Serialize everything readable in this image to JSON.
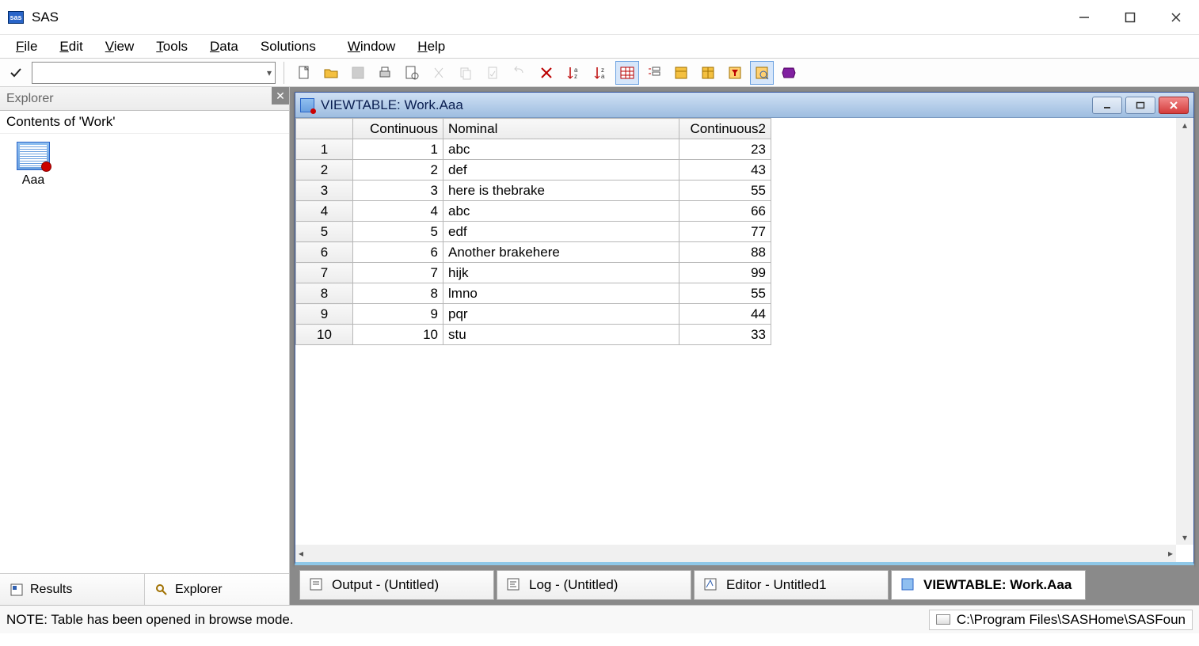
{
  "app": {
    "title": "SAS"
  },
  "menu": {
    "file": "File",
    "edit": "Edit",
    "view": "View",
    "tools": "Tools",
    "data": "Data",
    "solutions": "Solutions",
    "window": "Window",
    "help": "Help"
  },
  "explorer": {
    "title": "Explorer",
    "contents_label": "Contents of 'Work'",
    "item": "Aaa"
  },
  "left_tabs": {
    "results": "Results",
    "explorer": "Explorer"
  },
  "mdi": {
    "title": "VIEWTABLE: Work.Aaa"
  },
  "grid": {
    "cols": [
      "Continuous",
      "Nominal",
      "Continuous2"
    ],
    "rows": [
      {
        "n": 1,
        "c": 1,
        "nom": "abc",
        "c2": 23
      },
      {
        "n": 2,
        "c": 2,
        "nom": "def",
        "c2": 43
      },
      {
        "n": 3,
        "c": 3,
        "nom": "here is thebrake",
        "c2": 55
      },
      {
        "n": 4,
        "c": 4,
        "nom": "abc",
        "c2": 66
      },
      {
        "n": 5,
        "c": 5,
        "nom": "edf",
        "c2": 77
      },
      {
        "n": 6,
        "c": 6,
        "nom": "Another brakehere",
        "c2": 88
      },
      {
        "n": 7,
        "c": 7,
        "nom": "hijk",
        "c2": 99
      },
      {
        "n": 8,
        "c": 8,
        "nom": "lmno",
        "c2": 55
      },
      {
        "n": 9,
        "c": 9,
        "nom": "pqr",
        "c2": 44
      },
      {
        "n": 10,
        "c": 10,
        "nom": "stu",
        "c2": 33
      }
    ]
  },
  "bottom_tabs": {
    "output": "Output - (Untitled)",
    "log": "Log - (Untitled)",
    "editor": "Editor - Untitled1",
    "viewtable": "VIEWTABLE: Work.Aaa"
  },
  "status": {
    "note": "NOTE: Table has been opened in browse mode.",
    "path": "C:\\Program Files\\SASHome\\SASFoun"
  }
}
